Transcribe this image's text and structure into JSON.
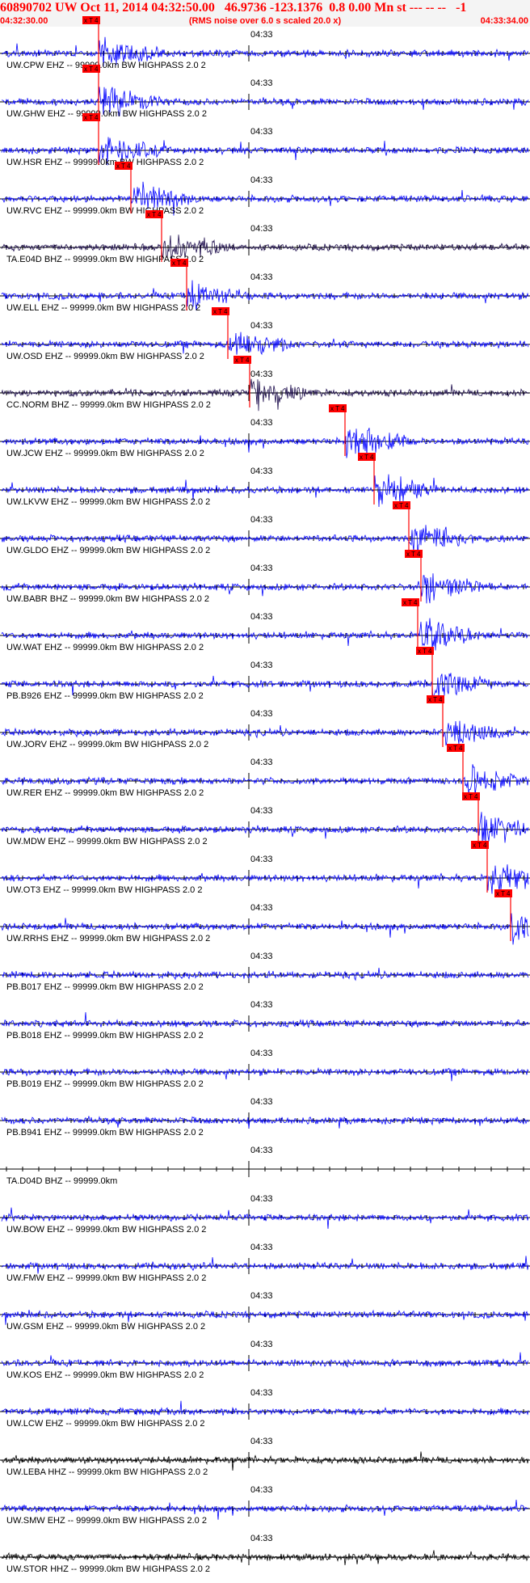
{
  "header": {
    "title": "60890702 UW Oct 11, 2014 04:32:50.00   46.9736 -123.1376  0.8 0.00 Mn st --- -- --   -1",
    "start_time": "04:32:30.00",
    "noise_note": "(RMS noise over 6.0 s scaled 20.0 x)",
    "end_time": "04:33:34.00"
  },
  "colors": {
    "header_text": "#ff0000",
    "pick": "#ff0000",
    "trace_blue": "#0000ff",
    "trace_dark": "#1a0a4a",
    "trace_black": "#000000",
    "axis": "#000000",
    "label": "#000000"
  },
  "chart_data": {
    "type": "seismogram",
    "time_axis": {
      "start": "04:32:30.00",
      "end": "04:33:34.00",
      "minute_label": "04:33"
    },
    "pick_label": "x T 4",
    "channels": [
      {
        "label": "UW.CPW EHZ -- 99999.0km BW  HIGHPASS  2.0  2",
        "color": "blue",
        "pick_s": 0.0
      },
      {
        "label": "UW.GHW EHZ -- 99999.0km BW  HIGHPASS  2.0  2",
        "color": "blue",
        "pick_s": 0.0
      },
      {
        "label": "UW.HSR EHZ -- 99999.0km BW  HIGHPASS  2.0  2",
        "color": "blue",
        "pick_s": 0.0
      },
      {
        "label": "UW.RVC EHZ -- 99999.0km BW  HIGHPASS  2.0  2",
        "color": "blue",
        "pick_s": 0.0
      },
      {
        "label": "TA.E04D BHZ -- 99999.0km BW  HIGHPASS  2.0  2",
        "color": "dark",
        "pick_s": 0.0
      },
      {
        "label": "UW.ELL EHZ -- 99999.0km BW  HIGHPASS  2.0  2",
        "color": "blue",
        "pick_s": 0.0
      },
      {
        "label": "UW.OSD EHZ -- 99999.0km BW  HIGHPASS  2.0  2",
        "color": "blue",
        "pick_s": 0.0
      },
      {
        "label": "CC.NORM BHZ -- 99999.0km BW  HIGHPASS  2.0  2",
        "color": "dark",
        "pick_s": 0.0
      },
      {
        "label": "UW.JCW EHZ -- 99999.0km BW  HIGHPASS  2.0  2",
        "color": "blue",
        "pick_s": 0.0
      },
      {
        "label": "UW.LKVW EHZ -- 99999.0km BW  HIGHPASS  2.0  2",
        "color": "blue",
        "pick_s": 0.0
      },
      {
        "label": "UW.GLDO EHZ -- 99999.0km BW  HIGHPASS  2.0  2",
        "color": "blue",
        "pick_s": 0.0
      },
      {
        "label": "UW.BABR BHZ -- 99999.0km BW  HIGHPASS  2.0  2",
        "color": "blue",
        "pick_s": 0.0
      },
      {
        "label": "UW.WAT EHZ -- 99999.0km BW  HIGHPASS  2.0  2",
        "color": "blue",
        "pick_s": 0.0
      },
      {
        "label": "PB.B926 EHZ -- 99999.0km BW  HIGHPASS  2.0  2",
        "color": "blue",
        "pick_s": 0.0
      },
      {
        "label": "UW.JORV EHZ -- 99999.0km BW  HIGHPASS  2.0  2",
        "color": "blue",
        "pick_s": 0.0
      },
      {
        "label": "UW.RER EHZ -- 99999.0km BW  HIGHPASS  2.0  2",
        "color": "blue",
        "pick_s": 0.0
      },
      {
        "label": "UW.MDW EHZ -- 99999.0km BW  HIGHPASS  2.0  2",
        "color": "blue",
        "pick_s": 0.0
      },
      {
        "label": "UW.OT3 EHZ -- 99999.0km BW  HIGHPASS  2.0  2",
        "color": "blue",
        "pick_s": 0.0
      },
      {
        "label": "UW.RRHS EHZ -- 99999.0km BW  HIGHPASS  2.0  2",
        "color": "blue",
        "pick_s": 0.0
      },
      {
        "label": "PB.B017 EHZ -- 99999.0km BW  HIGHPASS  2.0  2",
        "color": "blue"
      },
      {
        "label": "PB.B018 EHZ -- 99999.0km BW  HIGHPASS  2.0  2",
        "color": "blue"
      },
      {
        "label": "PB.B019 EHZ -- 99999.0km BW  HIGHPASS  2.0  2",
        "color": "blue"
      },
      {
        "label": "PB.B941 EHZ -- 99999.0km BW  HIGHPASS  2.0  2",
        "color": "blue"
      },
      {
        "label": "TA.D04D BHZ -- 99999.0km",
        "color": "none"
      },
      {
        "label": "UW.BOW EHZ -- 99999.0km BW  HIGHPASS  2.0  2",
        "color": "blue"
      },
      {
        "label": "UW.FMW EHZ -- 99999.0km BW  HIGHPASS  2.0  2",
        "color": "blue"
      },
      {
        "label": "UW.GSM EHZ -- 99999.0km BW  HIGHPASS  2.0  2",
        "color": "blue"
      },
      {
        "label": "UW.KOS EHZ -- 99999.0km BW  HIGHPASS  2.0  2",
        "color": "blue"
      },
      {
        "label": "UW.LCW EHZ -- 99999.0km BW  HIGHPASS  2.0  2",
        "color": "blue"
      },
      {
        "label": "UW.LEBA HHZ -- 99999.0km BW  HIGHPASS  2.0  2",
        "color": "black"
      },
      {
        "label": "UW.SMW EHZ -- 99999.0km BW  HIGHPASS  2.0  2",
        "color": "blue"
      },
      {
        "label": "UW.STOR HHZ -- 99999.0km BW  HIGHPASS  2.0  2",
        "color": "black"
      }
    ]
  }
}
